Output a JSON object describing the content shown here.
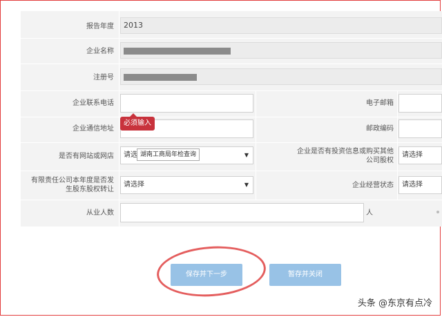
{
  "form": {
    "report_year_label": "报告年度",
    "report_year_value": "2013",
    "company_name_label": "企业名称",
    "reg_number_label": "注册号",
    "phone_label": "企业联系电话",
    "email_label": "电子邮箱",
    "address_label": "企业通信地址",
    "postcode_label": "邮政编码",
    "website_label": "是否有网站或网店",
    "website_select": "请选",
    "investment_label": "企业是否有投资信息或购买其他公司股权",
    "investment_select": "请选择",
    "equity_transfer_label": "有限责任公司本年度是否发生股东股权转让",
    "equity_transfer_select": "请选择",
    "operation_status_label": "企业经营状态",
    "operation_status_select": "请选择",
    "employees_label": "从业人数",
    "employees_unit": "人"
  },
  "validation": {
    "required_tooltip": "必须输入"
  },
  "hint_tooltip": "湖南工商局年检查询",
  "buttons": {
    "save_next": "保存并下一步",
    "save_close": "暂存并关闭"
  },
  "watermark": "头条 @东京有点冷"
}
